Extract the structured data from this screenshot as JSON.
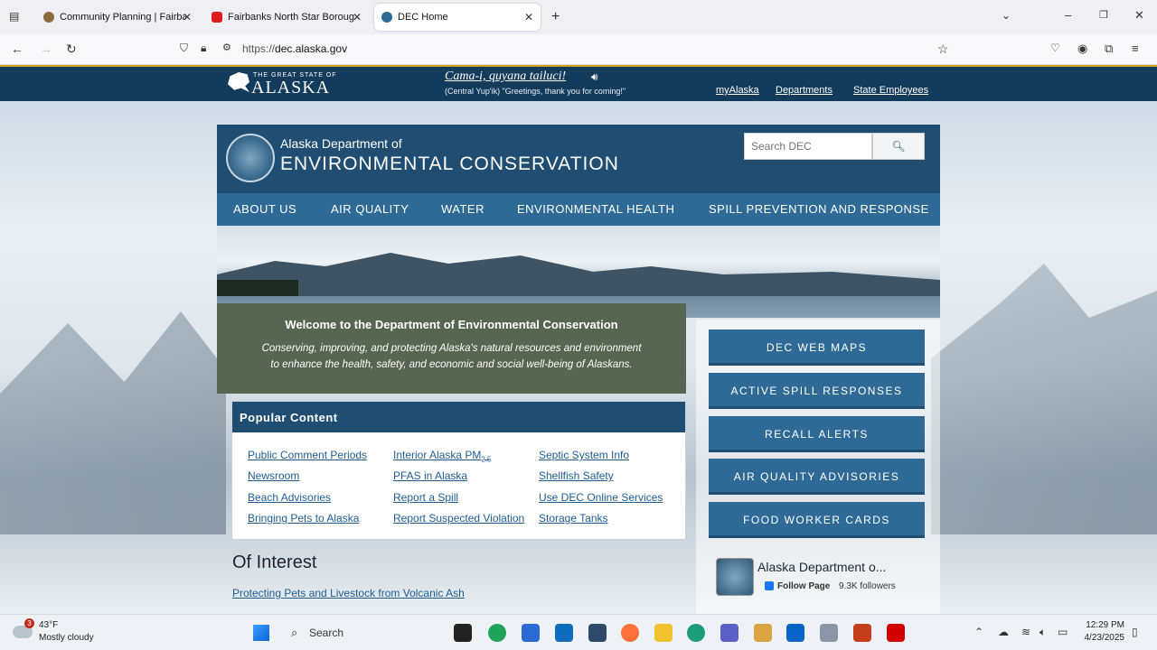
{
  "browser": {
    "tabs": [
      {
        "title": "Community Planning | Fairbank",
        "favicon_color": "#8a6d3b"
      },
      {
        "title": "Fairbanks North Star Borough -",
        "favicon_color": "#e01b1b"
      },
      {
        "title": "DEC Home",
        "favicon_color": "#2f6a96"
      }
    ],
    "url_prefix": "https://",
    "url_domain": "dec.alaska.gov"
  },
  "alaska_bar": {
    "logo_small": "THE GREAT STATE OF",
    "logo_big": "ALASKA",
    "greeting": "Cama-i, quyana tailuci!",
    "greeting_sub": "(Central Yup'ik)   \"Greetings, thank you for coming!\"",
    "links": [
      "myAlaska",
      "Departments",
      "State Employees"
    ]
  },
  "dec_header": {
    "pre_title": "Alaska Department of",
    "title": "ENVIRONMENTAL CONSERVATION",
    "search_placeholder": "Search DEC",
    "search_button_icon": "search-icon"
  },
  "nav": [
    "ABOUT US",
    "AIR QUALITY",
    "WATER",
    "ENVIRONMENTAL HEALTH",
    "SPILL PREVENTION AND RESPONSE"
  ],
  "welcome": {
    "heading": "Welcome to the Department of Environmental Conservation",
    "line1": "Conserving, improving, and protecting Alaska's natural resources and environment",
    "line2": "to enhance the health, safety, and economic and social well-being of Alaskans."
  },
  "popular": {
    "heading": "Popular Content",
    "col1": [
      "Public Comment Periods",
      "Newsroom",
      "Beach Advisories",
      "Bringing Pets to Alaska"
    ],
    "col2_first_main": "Interior Alaska PM",
    "col2_first_sub": "2.5",
    "col2": [
      "PFAS in Alaska",
      "Report a Spill",
      "Report Suspected Violation"
    ],
    "col3": [
      "Septic System Info",
      "Shellfish Safety",
      "Use DEC Online Services",
      "Storage Tanks"
    ]
  },
  "of_interest": {
    "heading": "Of Interest",
    "link": "Protecting Pets and Livestock from Volcanic Ash"
  },
  "quick_buttons": [
    "DEC WEB MAPS",
    "ACTIVE SPILL RESPONSES",
    "RECALL ALERTS",
    "AIR QUALITY ADVISORIES",
    "FOOD WORKER CARDS"
  ],
  "facebook": {
    "name": "Alaska Department o...",
    "follow": "Follow Page",
    "followers": "9.3K followers"
  },
  "taskbar": {
    "weather_temp": "43°F",
    "weather_desc": "Mostly cloudy",
    "weather_badge": "3",
    "search_label": "Search",
    "time": "12:29 PM",
    "date": "4/23/2025"
  },
  "colors": {
    "dec_blue": "#1f4e72",
    "nav_blue": "#2f6a96",
    "welcome_green": "#566650",
    "alaska_navy": "#133b5c"
  }
}
